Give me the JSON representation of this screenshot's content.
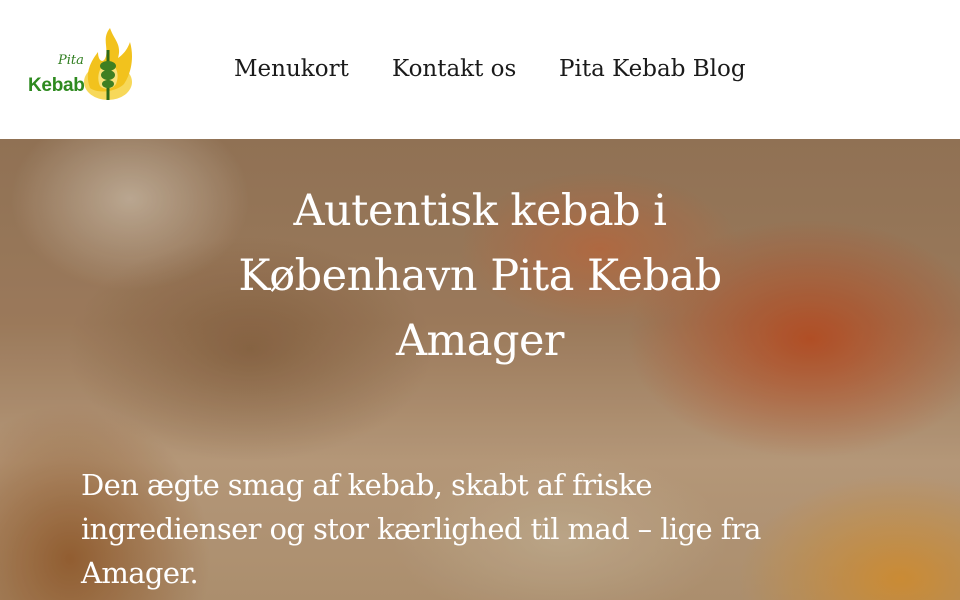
{
  "logo": {
    "script_text": "Pita",
    "word_text": "Kebab"
  },
  "nav": {
    "items": [
      {
        "label": "Menukort"
      },
      {
        "label": "Kontakt os"
      },
      {
        "label": "Pita Kebab Blog"
      }
    ]
  },
  "hero": {
    "title": "Autentisk kebab i København Pita Kebab Amager",
    "text": "Den ægte smag af kebab, skabt af friske ingredienser og stor kærlighed til mad – lige fra Amager."
  },
  "colors": {
    "logo_green": "#2e8a1f",
    "logo_flame": "#f2c21d",
    "nav_text": "#1a1a1a",
    "hero_text": "#ffffff"
  }
}
